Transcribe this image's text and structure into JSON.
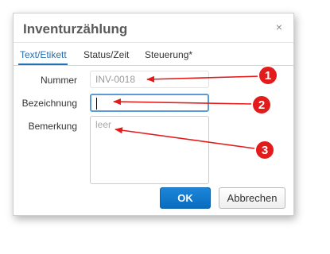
{
  "dialog": {
    "title": "Inventurzählung",
    "close_symbol": "×"
  },
  "tabs": [
    {
      "label": "Text/Etikett",
      "active": true
    },
    {
      "label": "Status/Zeit",
      "active": false
    },
    {
      "label": "Steuerung*",
      "active": false
    }
  ],
  "form": {
    "nummer_label": "Nummer",
    "nummer_value": "INV-0018",
    "bezeichnung_label": "Bezeichnung",
    "bezeichnung_value": "",
    "bemerkung_label": "Bemerkung",
    "bemerkung_placeholder": "leer"
  },
  "buttons": {
    "ok_label": "OK",
    "cancel_label": "Abbrechen"
  },
  "callouts": [
    {
      "number": "1",
      "target": "nummer-field"
    },
    {
      "number": "2",
      "target": "bezeichnung-field"
    },
    {
      "number": "3",
      "target": "bemerkung-field"
    }
  ],
  "colors": {
    "accent": "#1f6fb8",
    "callout_red": "#e31b1b",
    "ok_button": "#0a6cbf"
  },
  "icons": {
    "close": "close-icon"
  }
}
